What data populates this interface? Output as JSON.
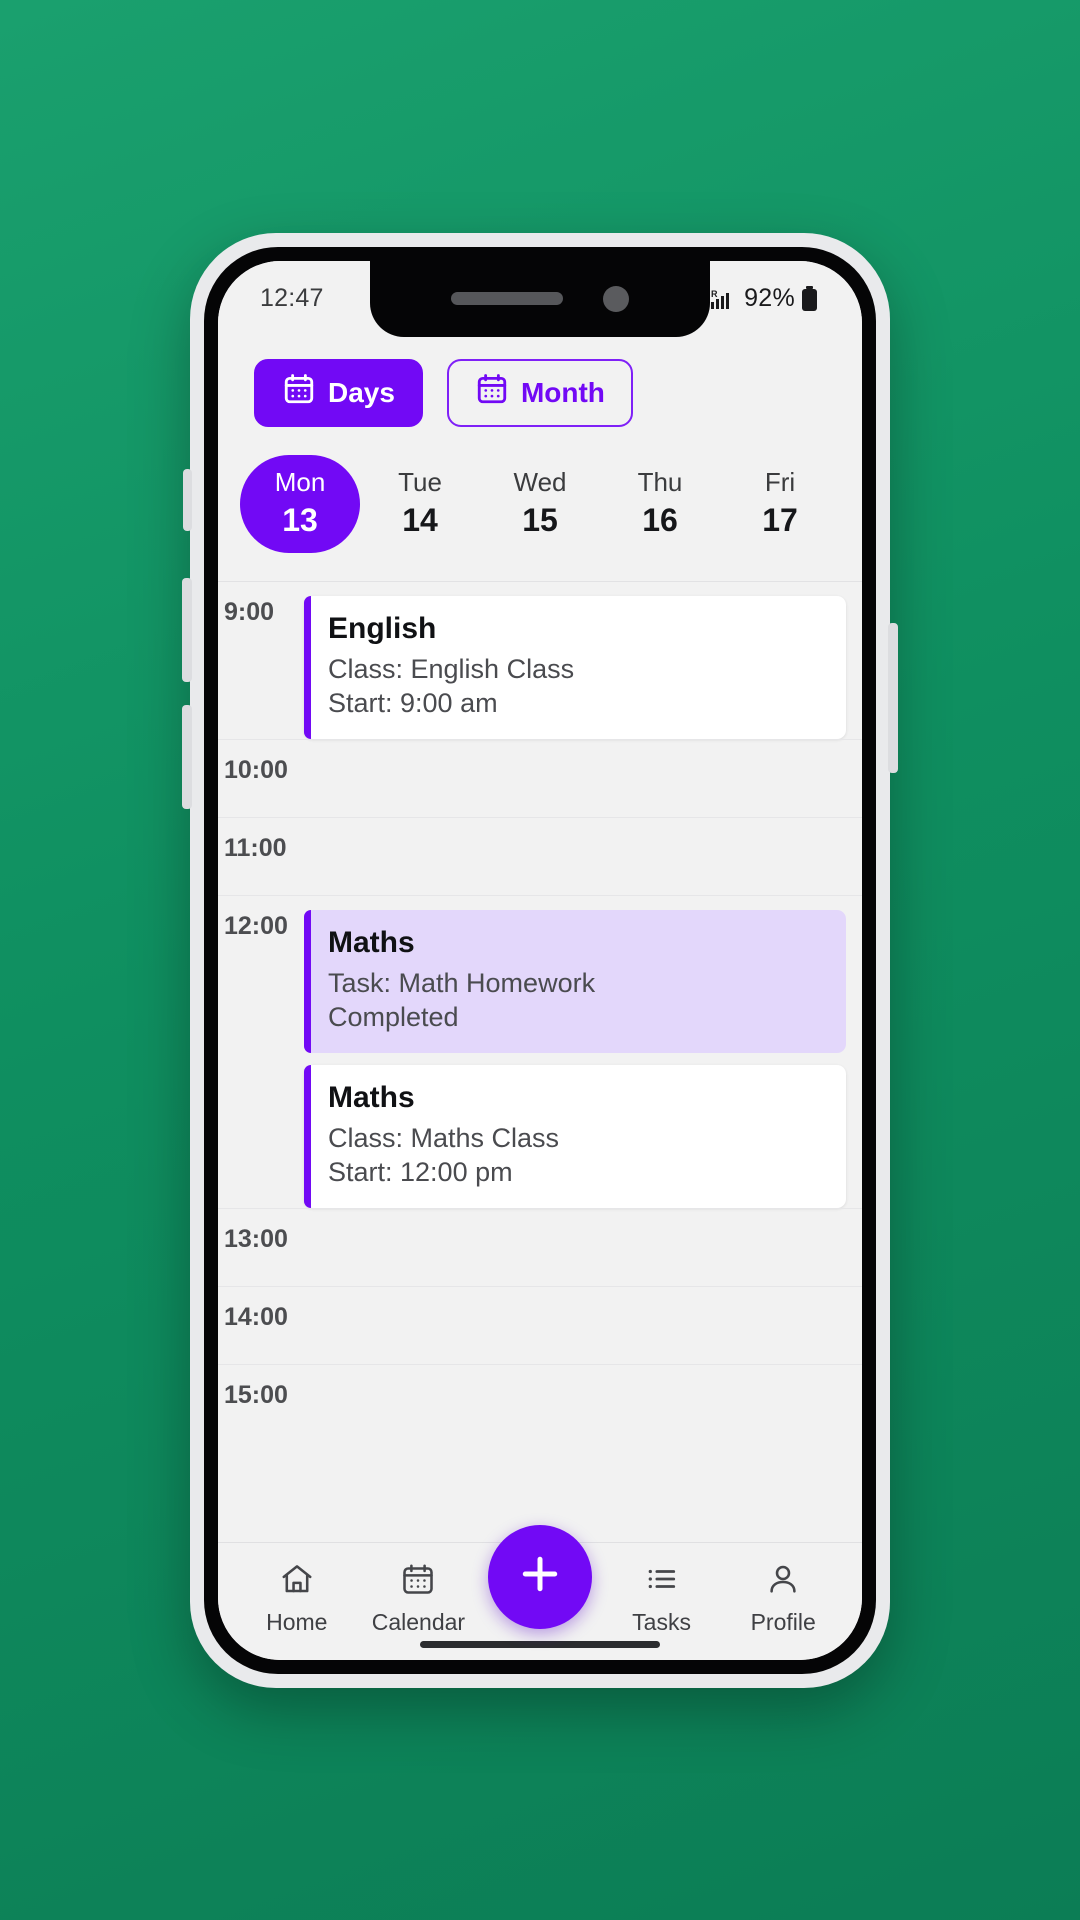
{
  "status_bar": {
    "time": "12:47",
    "battery_percent": "92%",
    "icons": [
      "wifi-icon",
      "signal-icon",
      "battery-icon"
    ]
  },
  "view_toggle": {
    "days_label": "Days",
    "month_label": "Month",
    "active": "Days",
    "icon": "calendar-icon"
  },
  "week_strip": {
    "days": [
      {
        "name": "Mon",
        "num": "13",
        "selected": true
      },
      {
        "name": "Tue",
        "num": "14",
        "selected": false
      },
      {
        "name": "Wed",
        "num": "15",
        "selected": false
      },
      {
        "name": "Thu",
        "num": "16",
        "selected": false
      },
      {
        "name": "Fri",
        "num": "17",
        "selected": false
      }
    ]
  },
  "agenda": {
    "hours": [
      {
        "label": "9:00",
        "events": [
          {
            "title": "English",
            "line1": "Class: English Class",
            "line2": "Start: 9:00 am",
            "style": "plain"
          }
        ]
      },
      {
        "label": "10:00",
        "events": []
      },
      {
        "label": "11:00",
        "events": []
      },
      {
        "label": "12:00",
        "events": [
          {
            "title": "Maths",
            "line1": "Task: Math Homework",
            "line2": "Completed",
            "style": "highlight"
          },
          {
            "title": "Maths",
            "line1": "Class: Maths Class",
            "line2": "Start: 12:00 pm",
            "style": "plain"
          }
        ]
      },
      {
        "label": "13:00",
        "events": []
      },
      {
        "label": "14:00",
        "events": []
      },
      {
        "label": "15:00",
        "events": []
      }
    ]
  },
  "bottom_nav": {
    "items": [
      {
        "label": "Home",
        "icon": "home-icon"
      },
      {
        "label": "Calendar",
        "icon": "calendar-icon"
      },
      {
        "label": "Tasks",
        "icon": "list-icon"
      },
      {
        "label": "Profile",
        "icon": "person-icon"
      }
    ],
    "fab": {
      "icon": "plus-icon",
      "label": "+"
    }
  },
  "colors": {
    "accent": "#7209f5",
    "highlight_bg": "#e3d7fb",
    "screen_bg": "#f2f2f2",
    "card_bg": "#ffffff"
  }
}
